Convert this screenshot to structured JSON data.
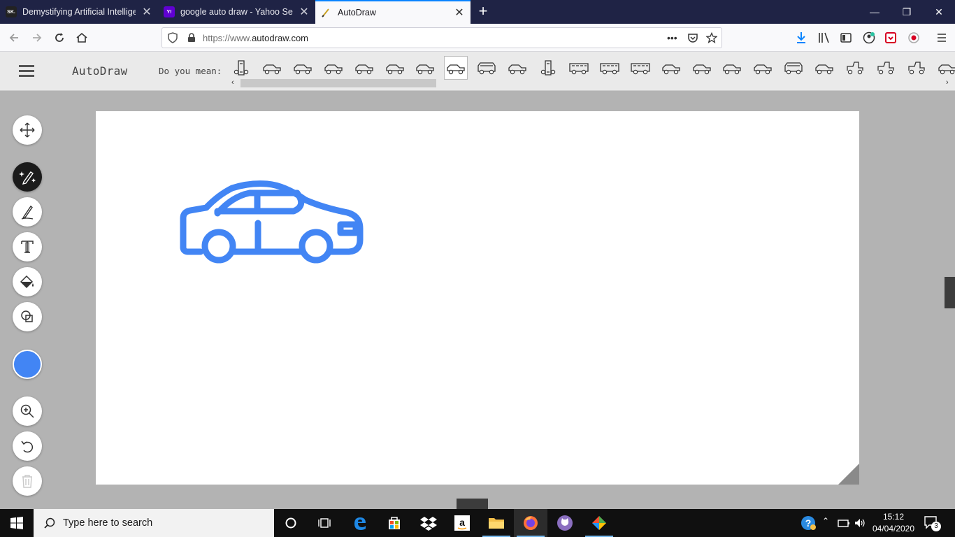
{
  "browser": {
    "tabs": [
      {
        "title": "Demystifying Artificial Intelligence",
        "favicon": "SK."
      },
      {
        "title": "google auto draw - Yahoo Search",
        "favicon": "Y!"
      },
      {
        "title": "AutoDraw",
        "favicon": ""
      }
    ],
    "url_prefix": "https://www.",
    "url_domain": "autodraw.com",
    "url_dots": "•••"
  },
  "autodraw": {
    "logo": "AutoDraw",
    "suggestion_prompt": "Do you mean:",
    "suggestion_icons": [
      "sugg-robot-icon",
      "sugg-tank-icon",
      "sugg-racecar-icon",
      "sugg-car-icon",
      "sugg-sportscar-icon",
      "sugg-sedan-icon",
      "sugg-car-front-icon",
      "sugg-car-icon",
      "sugg-jeep-icon",
      "sugg-car-side-icon",
      "sugg-phone-icon",
      "sugg-bus-icon",
      "sugg-trolley-icon",
      "sugg-firetruck-icon",
      "sugg-truck-icon",
      "sugg-forklift-icon",
      "sugg-lorry-icon",
      "sugg-pickup-icon",
      "sugg-suv-icon",
      "sugg-coupe-icon",
      "sugg-tractor-icon",
      "sugg-tractor-icon",
      "sugg-tractor-icon",
      "sugg-van-icon"
    ],
    "selected_suggestion": 7,
    "tools": [
      "move-icon",
      "autodraw-icon",
      "pencil-icon",
      "text-icon",
      "fill-icon",
      "shape-icon",
      "color-icon",
      "zoom-icon",
      "undo-icon",
      "trash-icon"
    ],
    "stroke_color": "#4285f4",
    "active_tool": "autodraw"
  },
  "taskbar": {
    "search_placeholder": "Type here to search",
    "time": "15:12",
    "date": "04/04/2020",
    "notifications": "3"
  }
}
